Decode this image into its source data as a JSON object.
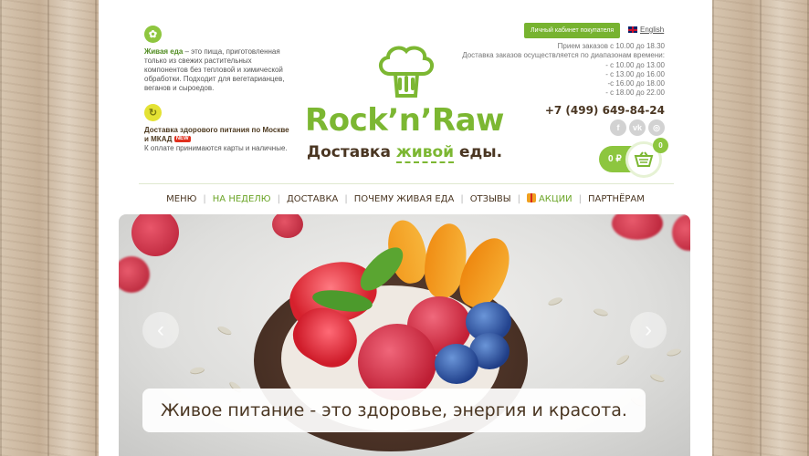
{
  "info": {
    "block1_bold": "Живая еда",
    "block1_text": " – это пища, приготовленная только из свежих растительных компонентов без тепловой и химической обработки. Подходит для вегетарианцев, веганов и сыроедов.",
    "block2_title": "Доставка здорового питания по Москве и МКАД",
    "block2_badge": "NEW",
    "block2_text": "К оплате принимаются карты и наличные."
  },
  "logo": {
    "name": "Rock’n’Raw",
    "tagline_start": "Доставка ",
    "tagline_highlight": "живой",
    "tagline_end": " еды."
  },
  "header": {
    "cabinet_label": "Личный кабинет покупателя",
    "language_label": "English",
    "hours_line1": "Прием заказов с 10.00 до 18.30",
    "hours_line2": "Доставка заказов осуществляется по диапазонам времени:",
    "slots": [
      "- с 10.00 до 13.00",
      "- с 13.00 до 16.00",
      "-с 16.00 до 18.00",
      "- с 18.00 до 22.00"
    ],
    "phone": "+7 (499) 649-84-24",
    "social": [
      "f",
      "vk",
      "ig"
    ]
  },
  "cart": {
    "amount": "0 ₽",
    "count": "0"
  },
  "nav": {
    "items": [
      "МЕНЮ",
      "НА НЕДЕЛЮ",
      "ДОСТАВКА",
      "ПОЧЕМУ ЖИВАЯ ЕДА",
      "ОТЗЫВЫ",
      "АКЦИИ",
      "ПАРТНЁРАМ"
    ]
  },
  "hero": {
    "caption": "Живое питание - это здоровье, энергия и красота.",
    "prev_icon": "‹",
    "next_icon": "›"
  },
  "colors": {
    "brand_green": "#7cb732",
    "brand_brown": "#4a3622"
  }
}
